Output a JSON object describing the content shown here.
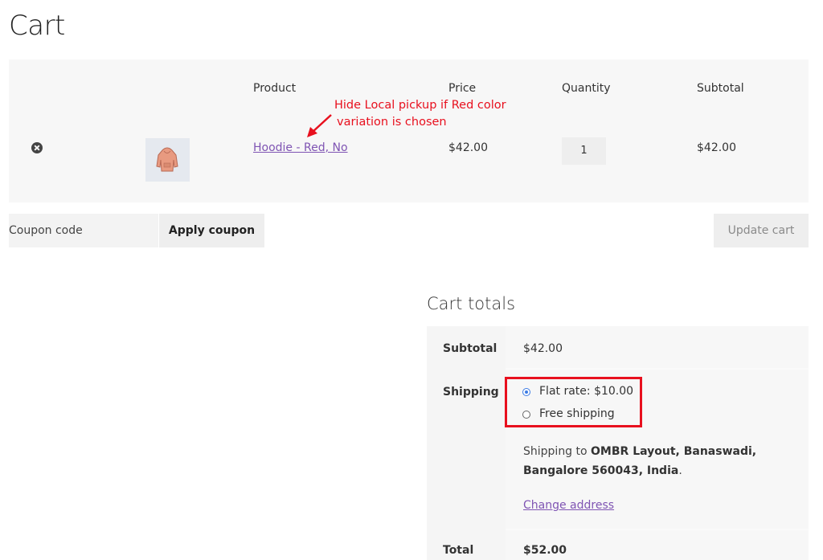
{
  "page": {
    "title": "Cart"
  },
  "cart_table": {
    "headers": {
      "product": "Product",
      "price": "Price",
      "quantity": "Quantity",
      "subtotal": "Subtotal"
    },
    "rows": [
      {
        "product_name": "Hoodie - Red, No",
        "price": "$42.00",
        "quantity": "1",
        "subtotal": "$42.00"
      }
    ]
  },
  "annotation": {
    "line1": "Hide Local pickup if Red color",
    "line2": "variation is chosen",
    "color": "#e8101e"
  },
  "coupon": {
    "placeholder": "Coupon code",
    "apply_label": "Apply coupon",
    "update_label": "Update cart"
  },
  "totals": {
    "title": "Cart totals",
    "subtotal_label": "Subtotal",
    "subtotal_value": "$42.00",
    "shipping_label": "Shipping",
    "shipping_options": [
      {
        "label": "Flat rate: $10.00",
        "selected": true
      },
      {
        "label": "Free shipping",
        "selected": false
      }
    ],
    "ship_to_prefix": "Shipping to ",
    "ship_to_address": "OMBR Layout, Banaswadi, Bangalore 560043, India",
    "ship_to_suffix": ".",
    "change_address": "Change address",
    "total_label": "Total",
    "total_value": "$52.00"
  },
  "colors": {
    "link": "#7f54b3",
    "accent_red": "#e8101e",
    "radio_blue": "#3b7be4"
  }
}
